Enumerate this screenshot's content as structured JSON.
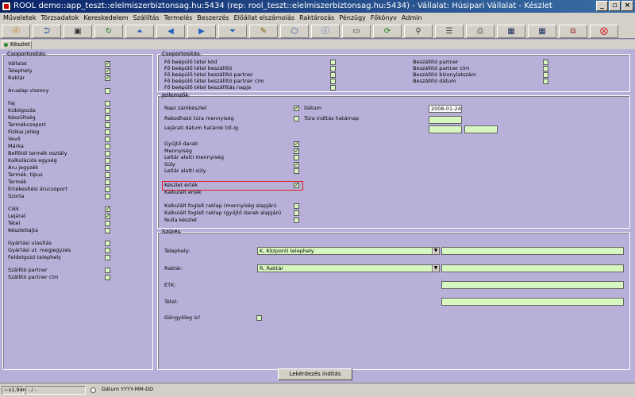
{
  "window": {
    "title": "ROOL demo::app_teszt::elelmiszerbiztonsag.hu:5434 (rep: rool_teszt::elelmiszerbiztonsag.hu:5434) - Vállalat: Húsipari Vállalat - Készlet",
    "minimize": "_",
    "restore": "▫",
    "close": "×"
  },
  "menu": [
    "Műveletek",
    "Törzsadatok",
    "Kereskedelem",
    "Szállítás",
    "Termelés",
    "Beszerzés",
    "Előállat elszámolás",
    "Raktározás",
    "Pénzügy",
    "Főkönyv",
    "Admin"
  ],
  "toolbar": [
    {
      "icon": "ⓓ",
      "color": "#c07000"
    },
    {
      "icon": "⮊",
      "color": "#2050a0"
    },
    {
      "icon": "▣",
      "color": "#303030"
    },
    {
      "icon": "↻",
      "color": "#208020"
    },
    {
      "icon": "⏶",
      "color": "#2060c0"
    },
    {
      "icon": "◀",
      "color": "#2060c0"
    },
    {
      "icon": "▶",
      "color": "#2060c0"
    },
    {
      "icon": "⏷",
      "color": "#2060c0"
    },
    {
      "icon": "✎",
      "color": "#806000"
    },
    {
      "icon": "⬡",
      "color": "#2050a0"
    },
    {
      "icon": "ⓘ",
      "color": "#2060c0"
    },
    {
      "icon": "▭",
      "color": "#404040"
    },
    {
      "icon": "⟳",
      "color": "#208020"
    },
    {
      "icon": "⚲",
      "color": "#404040"
    },
    {
      "icon": "☰",
      "color": "#404040"
    },
    {
      "icon": "⎙",
      "color": "#404040"
    },
    {
      "icon": "▦",
      "color": "#203060"
    },
    {
      "icon": "▦",
      "color": "#203060"
    },
    {
      "icon": "⧉",
      "color": "#a02020"
    },
    {
      "icon": "⨂",
      "color": "#d02020"
    }
  ],
  "tab": {
    "label": "Készlet"
  },
  "left_group": {
    "legend": "Csoportosítás",
    "items": [
      {
        "label": "Vállalat",
        "checked": true
      },
      {
        "label": "Telephely",
        "checked": true
      },
      {
        "label": "Raktár",
        "checked": true
      },
      {
        "label": "Árualap viszony",
        "checked": false
      },
      {
        "label": "Faj",
        "checked": false
      },
      {
        "label": "Kidolgozás",
        "checked": false
      },
      {
        "label": "Készültség",
        "checked": false
      },
      {
        "label": "Termékcsoport",
        "checked": false
      },
      {
        "label": "Fizikai jelleg",
        "checked": false
      },
      {
        "label": "Vevő",
        "checked": false
      },
      {
        "label": "Márka",
        "checked": false
      },
      {
        "label": "Belföldi termék osztály",
        "checked": false
      },
      {
        "label": "Kalkulációs egység",
        "checked": false
      },
      {
        "label": "Áru jegyzék",
        "checked": false
      },
      {
        "label": "Termék. típus",
        "checked": false
      },
      {
        "label": "Termék",
        "checked": false
      },
      {
        "label": "Értékesítési árucsoport",
        "checked": false
      },
      {
        "label": "Szorta",
        "checked": false
      },
      {
        "label": "Cikk",
        "checked": true
      },
      {
        "label": "Lejárat",
        "checked": true
      },
      {
        "label": "Tétel",
        "checked": false
      },
      {
        "label": "Készlettajta",
        "checked": false
      },
      {
        "label": "Gyártási utasítás",
        "checked": false
      },
      {
        "label": "Gyártási ut. megjegyzés",
        "checked": false
      },
      {
        "label": "Feldolgozó telephely",
        "checked": false
      },
      {
        "label": "Szállító partner",
        "checked": false
      },
      {
        "label": "Szállító partner cím",
        "checked": false
      }
    ]
  },
  "right_group": {
    "legend": "Csoportosítás",
    "col1": [
      {
        "label": "Fő beépülő tétel kód",
        "checked": false
      },
      {
        "label": "Fő beépülő tétel beszállító",
        "checked": false
      },
      {
        "label": "Fő beépülő tétel beszállító partner",
        "checked": false
      },
      {
        "label": "Fő beépülő tétel beszállító partner cím",
        "checked": false
      },
      {
        "label": "Fő beépülő tétel beszállítás napja",
        "checked": false
      }
    ],
    "col2": [
      {
        "label": "Beszállító partner",
        "checked": false
      },
      {
        "label": "Beszállító partner cím",
        "checked": false
      },
      {
        "label": "Beszállító bizonylatszám",
        "checked": false
      },
      {
        "label": "Beszállító dátum",
        "checked": false
      }
    ]
  },
  "features": {
    "legend": "Jellemzők",
    "napi": {
      "label": "Napi zárókészlet",
      "checked": true
    },
    "datum": {
      "label": "Dátum",
      "checked": true,
      "value": "2008-01-24"
    },
    "rakodhato": {
      "label": "Rakodható túra mennyiség",
      "checked": false
    },
    "tura": {
      "label": "Túra indítás határnap",
      "checked": false
    },
    "lejarati": {
      "label": "Lejárati dátum határok tól-ig"
    },
    "items": [
      {
        "label": "Gyűjtő darab",
        "checked": true
      },
      {
        "label": "Mennyiség",
        "checked": true
      },
      {
        "label": "Leltár alatti mennyiség",
        "checked": false
      },
      {
        "label": "Súly",
        "checked": true
      },
      {
        "label": "Leltár alatti súly",
        "checked": false
      }
    ],
    "keszlet_ertek": {
      "label": "Készlet érték",
      "checked": true
    },
    "kalkulalt_ertek": {
      "label": "Kalkulált érték",
      "checked": false
    },
    "items2": [
      {
        "label": "Kalkulált foglalt raklap (mennyiség alapján)",
        "checked": false
      },
      {
        "label": "Kalkulált foglalt raklap (gyűjtő darab alapján)",
        "checked": false
      },
      {
        "label": "Nulla készlet",
        "checked": false
      }
    ]
  },
  "filter": {
    "legend": "Szűrés",
    "telephely": {
      "label": "Telephely:",
      "value": "K, Központi telephely"
    },
    "raktar": {
      "label": "Raktár:",
      "value": "R, Raktár"
    },
    "etk": {
      "label": "ETK:"
    },
    "tetel": {
      "label": "Tétel:"
    },
    "gongyoleg": {
      "label": "Göngyöleg is?",
      "checked": false
    }
  },
  "query_button": "Lekérdezés indítás",
  "status": {
    "version": "~v1.94H",
    "sep": "- / -",
    "date": "Dátum YYYY-MM-DD"
  }
}
